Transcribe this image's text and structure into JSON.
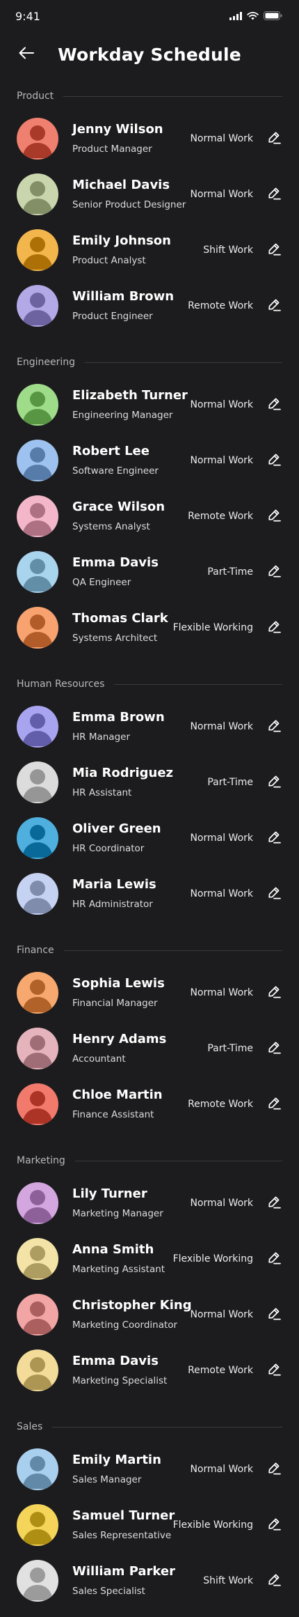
{
  "status_bar": {
    "time": "9:41"
  },
  "header": {
    "title": "Workday Schedule"
  },
  "colors": {
    "background": "#1c1c1e",
    "divider": "#3a3a3e",
    "section_label": "#b8b8bc"
  },
  "sections": [
    {
      "label": "Product",
      "members": [
        {
          "name": "Jenny Wilson",
          "role": "Product Manager",
          "work_type": "Normal Work",
          "avatar_color": "#ef7f6e"
        },
        {
          "name": "Michael Davis",
          "role": "Senior Product Designer",
          "work_type": "Normal Work",
          "avatar_color": "#c9d6ad"
        },
        {
          "name": "Emily Johnson",
          "role": "Product Analyst",
          "work_type": "Shift Work",
          "avatar_color": "#f2b64d"
        },
        {
          "name": "William Brown",
          "role": "Product Engineer",
          "work_type": "Remote Work",
          "avatar_color": "#b2a9e6"
        }
      ]
    },
    {
      "label": "Engineering",
      "members": [
        {
          "name": "Elizabeth Turner",
          "role": "Engineering Manager",
          "work_type": "Normal Work",
          "avatar_color": "#9fdc8a"
        },
        {
          "name": "Robert Lee",
          "role": "Software Engineer",
          "work_type": "Normal Work",
          "avatar_color": "#9ec2ef"
        },
        {
          "name": "Grace Wilson",
          "role": "Systems Analyst",
          "work_type": "Remote Work",
          "avatar_color": "#f4b7c9"
        },
        {
          "name": "Emma Davis",
          "role": "QA Engineer",
          "work_type": "Part-Time",
          "avatar_color": "#a9d4ee"
        },
        {
          "name": "Thomas Clark",
          "role": "Systems Architect",
          "work_type": "Flexible Working",
          "avatar_color": "#f7a26f"
        }
      ]
    },
    {
      "label": "Human Resources",
      "members": [
        {
          "name": "Emma Brown",
          "role": "HR Manager",
          "work_type": "Normal Work",
          "avatar_color": "#a9a4ef"
        },
        {
          "name": "Mia Rodriguez",
          "role": "HR Assistant",
          "work_type": "Part-Time",
          "avatar_color": "#dcdcdc"
        },
        {
          "name": "Oliver Green",
          "role": "HR Coordinator",
          "work_type": "Normal Work",
          "avatar_color": "#4fb0e0"
        },
        {
          "name": "Maria Lewis",
          "role": "HR Administrator",
          "work_type": "Normal Work",
          "avatar_color": "#c6d2f2"
        }
      ]
    },
    {
      "label": "Finance",
      "members": [
        {
          "name": "Sophia Lewis",
          "role": "Financial Manager",
          "work_type": "Normal Work",
          "avatar_color": "#f7a86f"
        },
        {
          "name": "Henry Adams",
          "role": "Accountant",
          "work_type": "Part-Time",
          "avatar_color": "#e4b3bb"
        },
        {
          "name": "Chloe Martin",
          "role": "Finance Assistant",
          "work_type": "Remote Work",
          "avatar_color": "#f27a6d"
        }
      ]
    },
    {
      "label": "Marketing",
      "members": [
        {
          "name": "Lily Turner",
          "role": "Marketing Manager",
          "work_type": "Normal Work",
          "avatar_color": "#d3a6e0"
        },
        {
          "name": "Anna Smith",
          "role": "Marketing Assistant",
          "work_type": "Flexible Working",
          "avatar_color": "#f3e3a6"
        },
        {
          "name": "Christopher King",
          "role": "Marketing Coordinator",
          "work_type": "Normal Work",
          "avatar_color": "#f2a5a5"
        },
        {
          "name": "Emma Davis",
          "role": "Marketing Specialist",
          "work_type": "Remote Work",
          "avatar_color": "#f3dc9a"
        }
      ]
    },
    {
      "label": "Sales",
      "members": [
        {
          "name": "Emily Martin",
          "role": "Sales Manager",
          "work_type": "Normal Work",
          "avatar_color": "#a9cfee"
        },
        {
          "name": "Samuel Turner",
          "role": "Sales Representative",
          "work_type": "Flexible Working",
          "avatar_color": "#f5d45a"
        },
        {
          "name": "William Parker",
          "role": "Sales Specialist",
          "work_type": "Shift Work",
          "avatar_color": "#e1e1e1"
        }
      ]
    }
  ],
  "icons": {
    "back": "arrow-left-icon",
    "edit": "pencil-icon",
    "signal": "cellular-signal-icon",
    "wifi": "wifi-icon",
    "battery": "battery-icon",
    "avatar": "person-avatar-icon"
  }
}
